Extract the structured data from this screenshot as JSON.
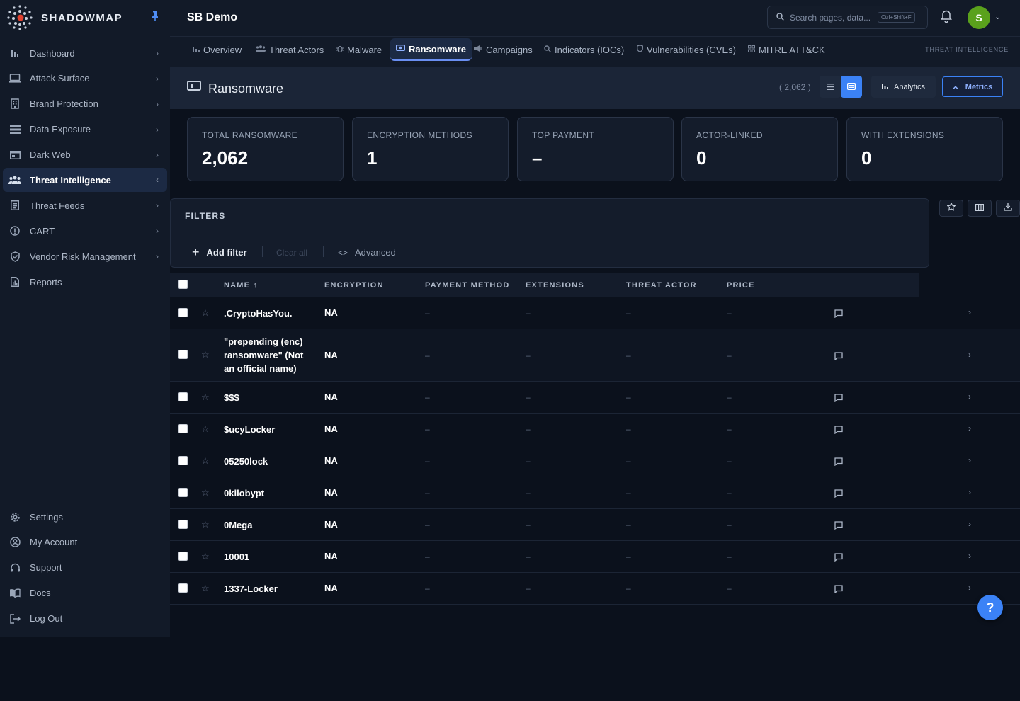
{
  "brand": {
    "name": "SHADOWMAP"
  },
  "sidebar": {
    "items": [
      {
        "label": "Dashboard",
        "icon": "bar-chart-icon",
        "expanded": false
      },
      {
        "label": "Attack Surface",
        "icon": "monitor-icon",
        "expanded": false
      },
      {
        "label": "Brand Protection",
        "icon": "building-icon",
        "expanded": false
      },
      {
        "label": "Data Exposure",
        "icon": "database-icon",
        "expanded": false
      },
      {
        "label": "Dark Web",
        "icon": "browser-icon",
        "expanded": false
      },
      {
        "label": "Threat Intelligence",
        "icon": "users-icon",
        "expanded": true,
        "active": true
      },
      {
        "label": "Threat Feeds",
        "icon": "document-icon",
        "expanded": false
      },
      {
        "label": "CART",
        "icon": "info-circle-icon",
        "expanded": false
      },
      {
        "label": "Vendor Risk Management",
        "icon": "shield-check-icon",
        "expanded": false
      },
      {
        "label": "Reports",
        "icon": "report-icon",
        "expanded": false
      }
    ],
    "bottom": [
      {
        "label": "Settings",
        "icon": "gear-icon"
      },
      {
        "label": "My Account",
        "icon": "user-circle-icon"
      },
      {
        "label": "Support",
        "icon": "headset-icon"
      },
      {
        "label": "Docs",
        "icon": "book-icon"
      },
      {
        "label": "Log Out",
        "icon": "logout-icon"
      }
    ]
  },
  "topbar": {
    "org": "SB Demo",
    "search_placeholder": "Search pages, data...",
    "search_shortcut": "Ctrl+Shift+F",
    "avatar_initial": "S"
  },
  "tabs": {
    "items": [
      {
        "label": "Overview",
        "icon": "bar-chart-icon"
      },
      {
        "label": "Threat Actors",
        "icon": "users-icon"
      },
      {
        "label": "Malware",
        "icon": "bug-icon"
      },
      {
        "label": "Ransomware",
        "icon": "ransomware-icon",
        "active": true
      },
      {
        "label": "Campaigns",
        "icon": "megaphone-icon"
      },
      {
        "label": "Indicators (IOCs)",
        "icon": "search-icon"
      },
      {
        "label": "Vulnerabilities (CVEs)",
        "icon": "shield-icon"
      },
      {
        "label": "MITRE ATT&CK",
        "icon": "grid-icon"
      }
    ],
    "section": "THREAT INTELLIGENCE"
  },
  "page": {
    "title": "Ransomware",
    "count": "( 2,062 )",
    "analytics_label": "Analytics",
    "metrics_label": "Metrics"
  },
  "metrics": [
    {
      "label": "TOTAL RANSOMWARE",
      "value": "2,062"
    },
    {
      "label": "ENCRYPTION METHODS",
      "value": "1"
    },
    {
      "label": "TOP PAYMENT",
      "value": "–"
    },
    {
      "label": "ACTOR-LINKED",
      "value": "0"
    },
    {
      "label": "WITH EXTENSIONS",
      "value": "0"
    }
  ],
  "filters": {
    "title": "FILTERS",
    "add_filter": "Add filter",
    "clear_all": "Clear all",
    "advanced": "Advanced"
  },
  "table": {
    "columns": [
      "NAME",
      "ENCRYPTION",
      "PAYMENT METHOD",
      "EXTENSIONS",
      "THREAT ACTOR",
      "PRICE"
    ],
    "sort_column": "NAME",
    "sort_direction": "ascending",
    "rows": [
      {
        "name": ".CryptoHasYou.",
        "encryption": "NA",
        "payment": "–",
        "extensions": "–",
        "actor": "–",
        "price": "–"
      },
      {
        "name": "\"prepending (enc) ransomware\" (Not an official name)",
        "encryption": "NA",
        "payment": "–",
        "extensions": "–",
        "actor": "–",
        "price": "–"
      },
      {
        "name": "$$$",
        "encryption": "NA",
        "payment": "–",
        "extensions": "–",
        "actor": "–",
        "price": "–"
      },
      {
        "name": "$ucyLocker",
        "encryption": "NA",
        "payment": "–",
        "extensions": "–",
        "actor": "–",
        "price": "–"
      },
      {
        "name": "05250lock",
        "encryption": "NA",
        "payment": "–",
        "extensions": "–",
        "actor": "–",
        "price": "–"
      },
      {
        "name": "0kilobypt",
        "encryption": "NA",
        "payment": "–",
        "extensions": "–",
        "actor": "–",
        "price": "–"
      },
      {
        "name": "0Mega",
        "encryption": "NA",
        "payment": "–",
        "extensions": "–",
        "actor": "–",
        "price": "–"
      },
      {
        "name": "10001",
        "encryption": "NA",
        "payment": "–",
        "extensions": "–",
        "actor": "–",
        "price": "–"
      },
      {
        "name": "1337-Locker",
        "encryption": "NA",
        "payment": "–",
        "extensions": "–",
        "actor": "–",
        "price": "–"
      }
    ]
  },
  "help_label": "?",
  "colors": {
    "accent": "#3b82f6",
    "background": "#0b111c",
    "sidebar": "#121a28",
    "avatar": "#5aa11c"
  }
}
